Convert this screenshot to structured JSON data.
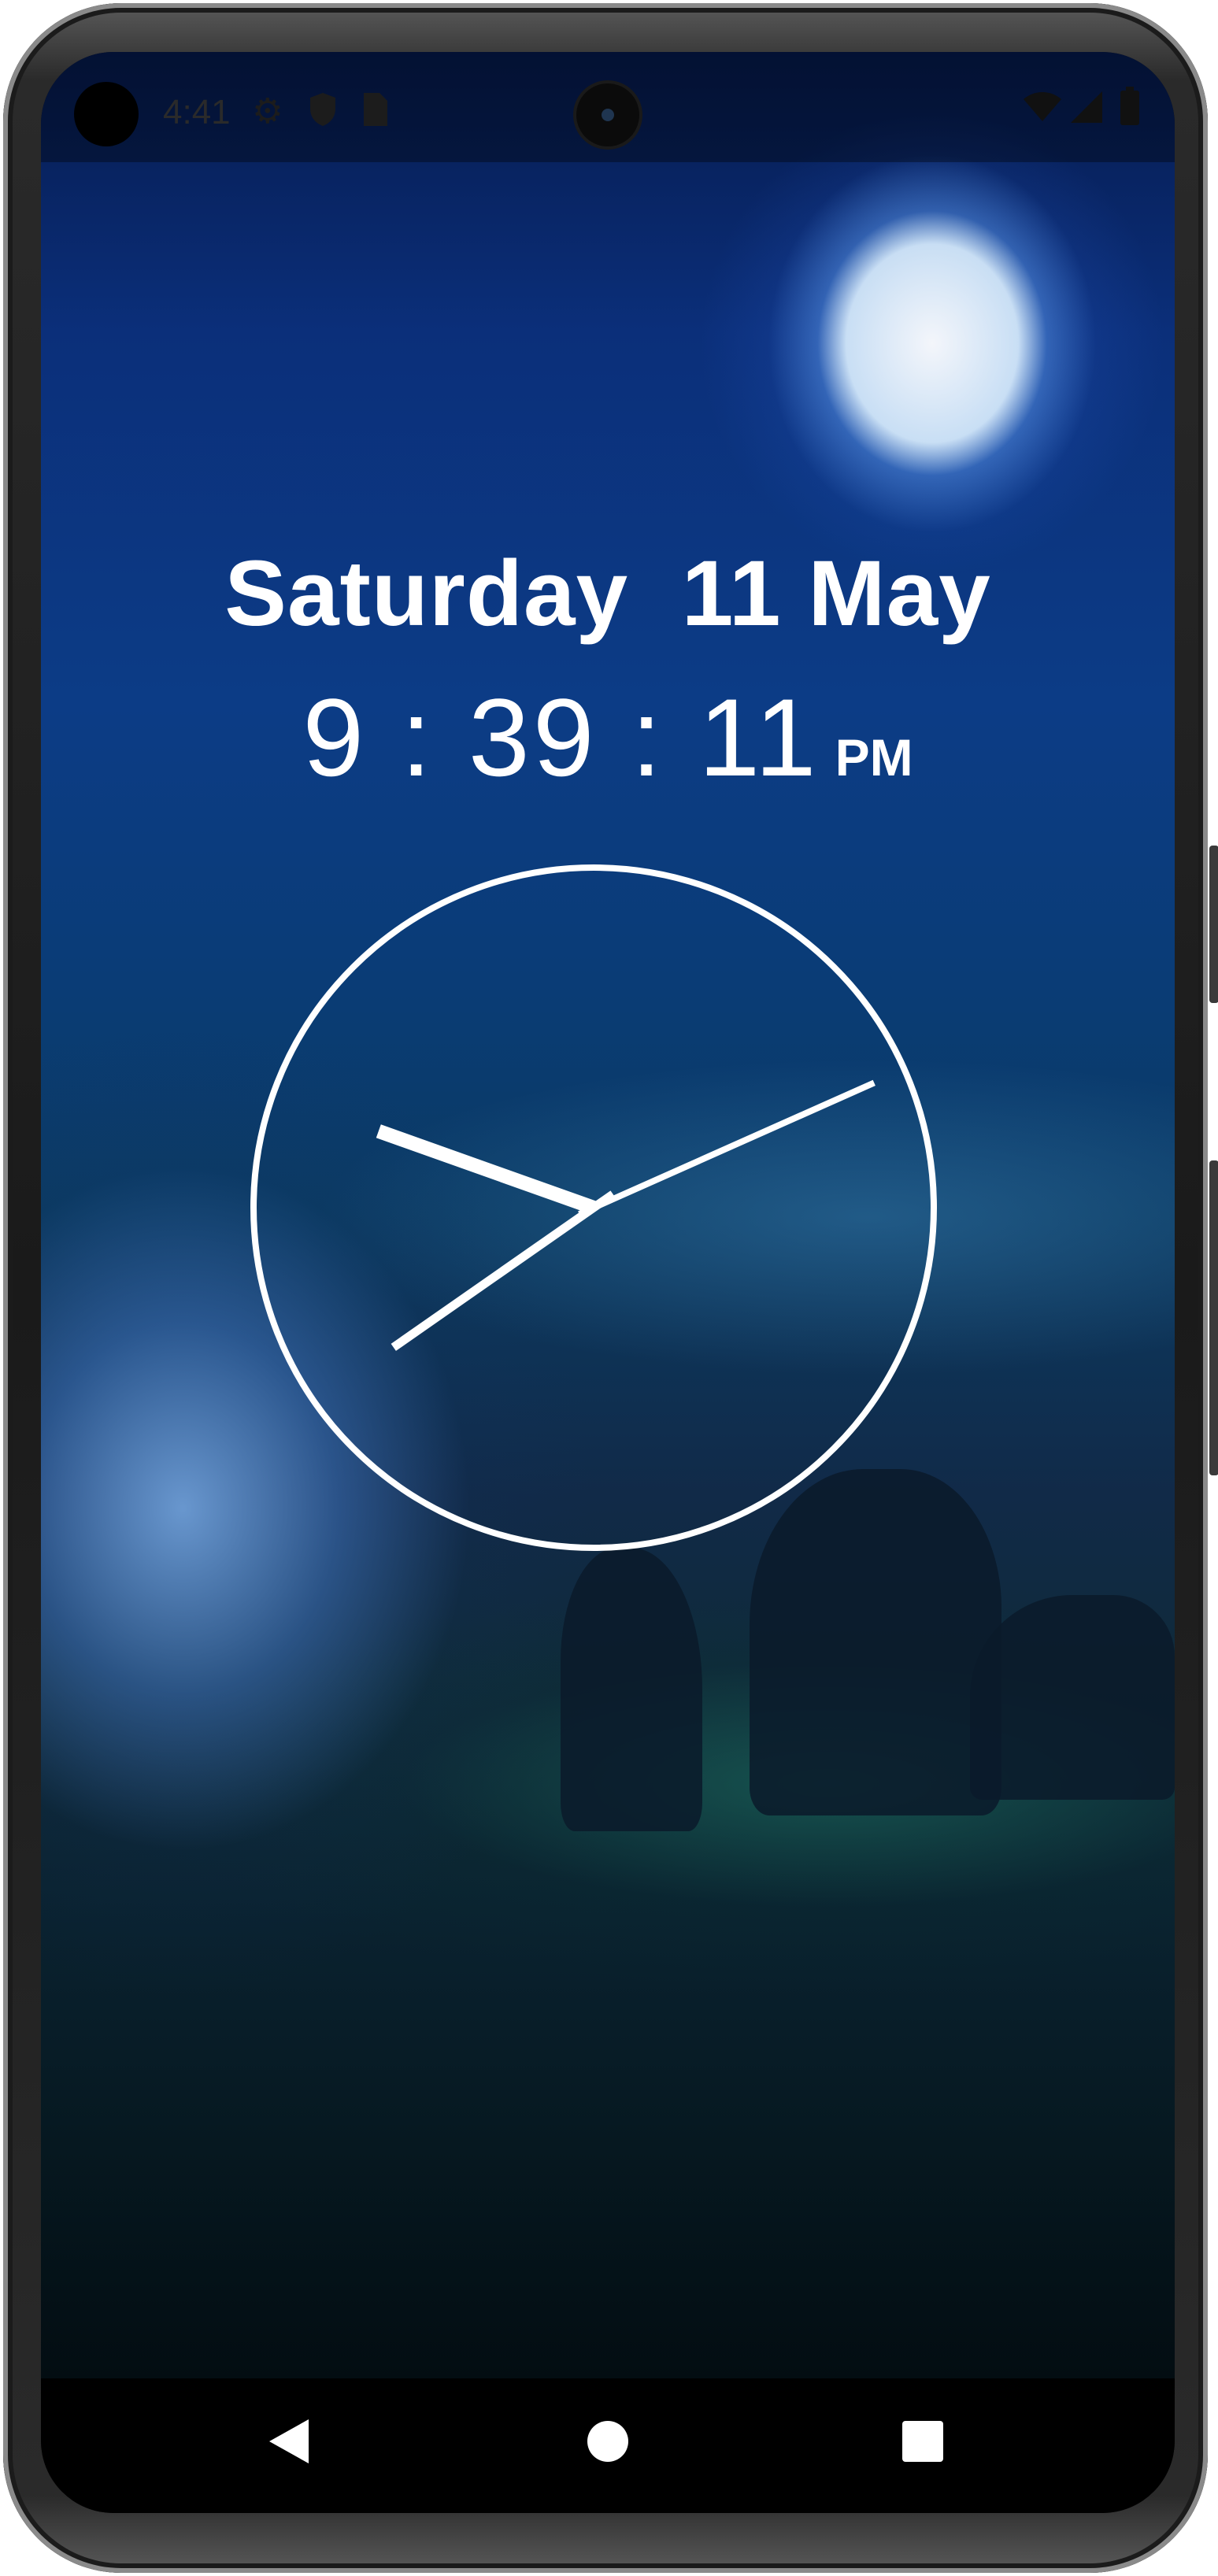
{
  "status_bar": {
    "time": "4:41",
    "icons": [
      "gear-icon",
      "shield-icon",
      "sim-card-icon"
    ],
    "right_icons": [
      "wifi-icon",
      "signal-icon",
      "battery-icon"
    ]
  },
  "lock_screen": {
    "date": "Saturday  11 May",
    "digital_time": "9 : 39 : 11",
    "ampm": "PM",
    "analog_clock": {
      "hour": 9,
      "minute": 39,
      "second": 11
    }
  },
  "navigation": {
    "buttons": [
      "back-icon",
      "home-icon",
      "recents-icon"
    ]
  },
  "colors": {
    "text": "#ffffff",
    "nav_background": "#000000"
  }
}
